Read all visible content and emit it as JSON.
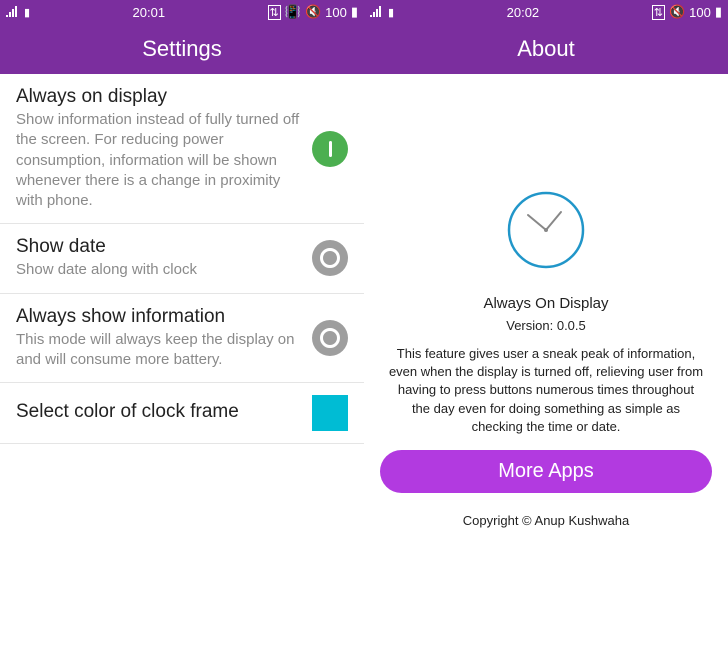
{
  "left": {
    "status": {
      "time": "20:01",
      "battery": "100"
    },
    "header": "Settings",
    "items": [
      {
        "title": "Always on display",
        "subtitle": "Show information instead of fully turned off the screen. For reducing power consumption, information will be shown whenever there is a change in proximity with phone.",
        "state": "on"
      },
      {
        "title": "Show date",
        "subtitle": "Show date along with clock",
        "state": "off"
      },
      {
        "title": "Always show information",
        "subtitle": "This mode will always keep the display on and will consume more battery.",
        "state": "off"
      },
      {
        "title": "Select color of clock frame",
        "subtitle": "",
        "color": "#00bcd4"
      }
    ]
  },
  "right": {
    "status": {
      "time": "20:02",
      "battery": "100"
    },
    "header": "About",
    "app_name": "Always On Display",
    "version": "Version: 0.0.5",
    "description": "This feature gives user a sneak peak of information, even when the display is turned off, relieving user from having to press buttons numerous times throughout the day even for doing something as simple as checking the time or date.",
    "more_apps": "More Apps",
    "copyright": "Copyright © Anup Kushwaha",
    "clock_color": "#2196c9"
  }
}
